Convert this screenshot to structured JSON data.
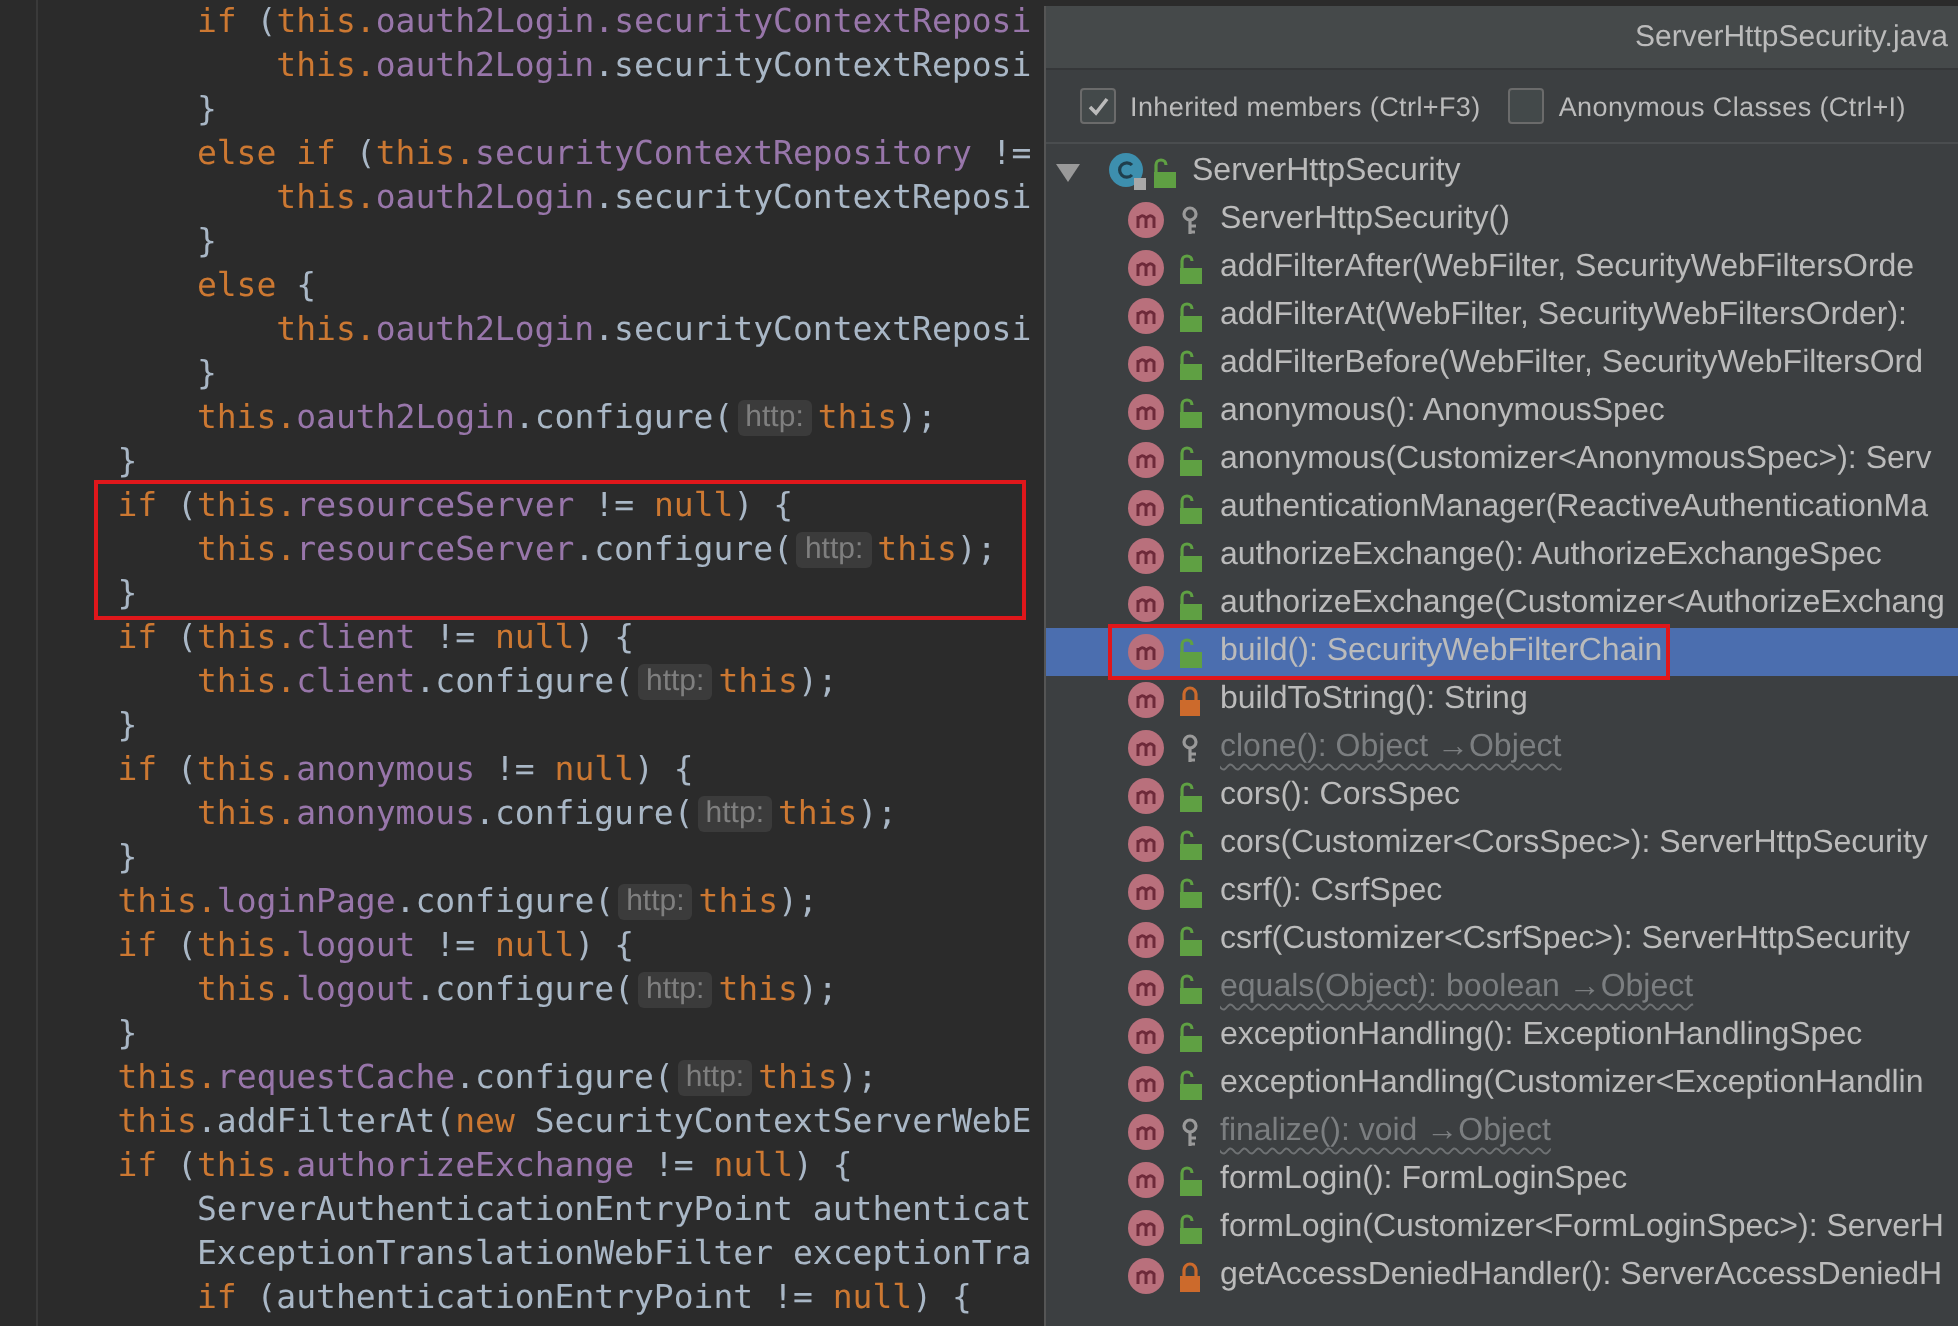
{
  "editor": {
    "lines": [
      {
        "boxed": false,
        "children": [
          {
            "parts": [
              {
                "kind": "code",
                "tokens": [
                  {
                    "kind": "kw",
                    "text": "if"
                  },
                  {
                    "kind": "plain",
                    "text": " ("
                  },
                  {
                    "kind": "kw",
                    "text": "this."
                  },
                  {
                    "kind": "field",
                    "text": "oauth2Login.securityContextReposi"
                  }
                ]
              }
            ],
            "children": [
              {
                "parts": [
                  {
                    "kind": "code",
                    "tokens": [
                      {
                        "kind": "kw",
                        "text": "this."
                      },
                      {
                        "kind": "field",
                        "text": "oauth2Login"
                      },
                      {
                        "kind": "plain",
                        "text": ".securityContextReposi"
                      }
                    ]
                  }
                ]
              }
            ],
            "closing": [
              {
                "kind": "code",
                "tokens": [
                  {
                    "kind": "plain",
                    "text": "}"
                  }
                ]
              }
            ]
          },
          {
            "parts": [
              {
                "kind": "code",
                "tokens": [
                  {
                    "kind": "kw",
                    "text": "else if"
                  },
                  {
                    "kind": "plain",
                    "text": " ("
                  },
                  {
                    "kind": "kw",
                    "text": "this."
                  },
                  {
                    "kind": "field",
                    "text": "securityContextRepository"
                  },
                  {
                    "kind": "plain",
                    "text": " !="
                  }
                ]
              }
            ],
            "children": [
              {
                "parts": [
                  {
                    "kind": "code",
                    "tokens": [
                      {
                        "kind": "kw",
                        "text": "this."
                      },
                      {
                        "kind": "field",
                        "text": "oauth2Login"
                      },
                      {
                        "kind": "plain",
                        "text": ".securityContextReposi"
                      }
                    ]
                  }
                ]
              }
            ],
            "closing": [
              {
                "kind": "code",
                "tokens": [
                  {
                    "kind": "plain",
                    "text": "}"
                  }
                ]
              }
            ]
          },
          {
            "parts": [
              {
                "kind": "code",
                "tokens": [
                  {
                    "kind": "kw",
                    "text": "else"
                  },
                  {
                    "kind": "plain",
                    "text": " {"
                  }
                ]
              }
            ],
            "children": [
              {
                "parts": [
                  {
                    "kind": "code",
                    "tokens": [
                      {
                        "kind": "kw",
                        "text": "this."
                      },
                      {
                        "kind": "field",
                        "text": "oauth2Login"
                      },
                      {
                        "kind": "plain",
                        "text": ".securityContextReposi"
                      }
                    ]
                  }
                ]
              }
            ],
            "closing": [
              {
                "kind": "code",
                "tokens": [
                  {
                    "kind": "plain",
                    "text": "}"
                  }
                ]
              }
            ]
          },
          {
            "parts": [
              {
                "kind": "code",
                "tokens": [
                  {
                    "kind": "kw",
                    "text": "this."
                  },
                  {
                    "kind": "field",
                    "text": "oauth2Login"
                  },
                  {
                    "kind": "plain",
                    "text": ".configure("
                  }
                ]
              },
              {
                "kind": "hint",
                "text": "http:"
              },
              {
                "kind": "code",
                "tokens": [
                  {
                    "kind": "kw",
                    "text": "this"
                  },
                  {
                    "kind": "plain",
                    "text": ");"
                  }
                ]
              }
            ]
          }
        ],
        "closing": [
          {
            "kind": "code",
            "tokens": [
              {
                "kind": "plain",
                "text": "}"
              }
            ]
          }
        ]
      },
      {
        "boxed": true,
        "parts": [
          {
            "kind": "code",
            "tokens": [
              {
                "kind": "kw",
                "text": "if"
              },
              {
                "kind": "plain",
                "text": " ("
              },
              {
                "kind": "kw",
                "text": "this."
              },
              {
                "kind": "field",
                "text": "resourceServer"
              },
              {
                "kind": "plain",
                "text": " != "
              },
              {
                "kind": "kw",
                "text": "null"
              },
              {
                "kind": "plain",
                "text": ") {"
              }
            ]
          }
        ],
        "children": [
          {
            "parts": [
              {
                "kind": "code",
                "tokens": [
                  {
                    "kind": "kw",
                    "text": "this."
                  },
                  {
                    "kind": "field",
                    "text": "resourceServer"
                  },
                  {
                    "kind": "plain",
                    "text": ".configure("
                  }
                ]
              },
              {
                "kind": "hint",
                "text": "http:"
              },
              {
                "kind": "code",
                "tokens": [
                  {
                    "kind": "kw",
                    "text": "this"
                  },
                  {
                    "kind": "plain",
                    "text": ");"
                  }
                ]
              }
            ]
          }
        ],
        "closing": [
          {
            "kind": "code",
            "tokens": [
              {
                "kind": "plain",
                "text": "}"
              }
            ]
          }
        ]
      },
      {
        "boxed": false,
        "parts": [
          {
            "kind": "code",
            "tokens": [
              {
                "kind": "kw",
                "text": "if"
              },
              {
                "kind": "plain",
                "text": " ("
              },
              {
                "kind": "kw",
                "text": "this."
              },
              {
                "kind": "field",
                "text": "client"
              },
              {
                "kind": "plain",
                "text": " != "
              },
              {
                "kind": "kw",
                "text": "null"
              },
              {
                "kind": "plain",
                "text": ") {"
              }
            ]
          }
        ],
        "children": [
          {
            "parts": [
              {
                "kind": "code",
                "tokens": [
                  {
                    "kind": "kw",
                    "text": "this."
                  },
                  {
                    "kind": "field",
                    "text": "client"
                  },
                  {
                    "kind": "plain",
                    "text": ".configure("
                  }
                ]
              },
              {
                "kind": "hint",
                "text": "http:"
              },
              {
                "kind": "code",
                "tokens": [
                  {
                    "kind": "kw",
                    "text": "this"
                  },
                  {
                    "kind": "plain",
                    "text": ");"
                  }
                ]
              }
            ]
          }
        ],
        "closing": [
          {
            "kind": "code",
            "tokens": [
              {
                "kind": "plain",
                "text": "}"
              }
            ]
          }
        ]
      },
      {
        "boxed": false,
        "parts": [
          {
            "kind": "code",
            "tokens": [
              {
                "kind": "kw",
                "text": "if"
              },
              {
                "kind": "plain",
                "text": " ("
              },
              {
                "kind": "kw",
                "text": "this."
              },
              {
                "kind": "field",
                "text": "anonymous"
              },
              {
                "kind": "plain",
                "text": " != "
              },
              {
                "kind": "kw",
                "text": "null"
              },
              {
                "kind": "plain",
                "text": ") {"
              }
            ]
          }
        ],
        "children": [
          {
            "parts": [
              {
                "kind": "code",
                "tokens": [
                  {
                    "kind": "kw",
                    "text": "this."
                  },
                  {
                    "kind": "field",
                    "text": "anonymous"
                  },
                  {
                    "kind": "plain",
                    "text": ".configure("
                  }
                ]
              },
              {
                "kind": "hint",
                "text": "http:"
              },
              {
                "kind": "code",
                "tokens": [
                  {
                    "kind": "kw",
                    "text": "this"
                  },
                  {
                    "kind": "plain",
                    "text": ");"
                  }
                ]
              }
            ]
          }
        ],
        "closing": [
          {
            "kind": "code",
            "tokens": [
              {
                "kind": "plain",
                "text": "}"
              }
            ]
          }
        ]
      },
      {
        "boxed": false,
        "parts": [
          {
            "kind": "code",
            "tokens": [
              {
                "kind": "kw",
                "text": "this."
              },
              {
                "kind": "field",
                "text": "loginPage"
              },
              {
                "kind": "plain",
                "text": ".configure("
              }
            ]
          },
          {
            "kind": "hint",
            "text": "http:"
          },
          {
            "kind": "code",
            "tokens": [
              {
                "kind": "kw",
                "text": "this"
              },
              {
                "kind": "plain",
                "text": ");"
              }
            ]
          }
        ]
      },
      {
        "boxed": false,
        "parts": [
          {
            "kind": "code",
            "tokens": [
              {
                "kind": "kw",
                "text": "if"
              },
              {
                "kind": "plain",
                "text": " ("
              },
              {
                "kind": "kw",
                "text": "this."
              },
              {
                "kind": "field",
                "text": "logout"
              },
              {
                "kind": "plain",
                "text": " != "
              },
              {
                "kind": "kw",
                "text": "null"
              },
              {
                "kind": "plain",
                "text": ") {"
              }
            ]
          }
        ],
        "children": [
          {
            "parts": [
              {
                "kind": "code",
                "tokens": [
                  {
                    "kind": "kw",
                    "text": "this."
                  },
                  {
                    "kind": "field",
                    "text": "logout"
                  },
                  {
                    "kind": "plain",
                    "text": ".configure("
                  }
                ]
              },
              {
                "kind": "hint",
                "text": "http:"
              },
              {
                "kind": "code",
                "tokens": [
                  {
                    "kind": "kw",
                    "text": "this"
                  },
                  {
                    "kind": "plain",
                    "text": ");"
                  }
                ]
              }
            ]
          }
        ],
        "closing": [
          {
            "kind": "code",
            "tokens": [
              {
                "kind": "plain",
                "text": "}"
              }
            ]
          }
        ]
      },
      {
        "boxed": false,
        "parts": [
          {
            "kind": "code",
            "tokens": [
              {
                "kind": "kw",
                "text": "this."
              },
              {
                "kind": "field",
                "text": "requestCache"
              },
              {
                "kind": "plain",
                "text": ".configure("
              }
            ]
          },
          {
            "kind": "hint",
            "text": "http:"
          },
          {
            "kind": "code",
            "tokens": [
              {
                "kind": "kw",
                "text": "this"
              },
              {
                "kind": "plain",
                "text": ");"
              }
            ]
          }
        ]
      },
      {
        "boxed": false,
        "parts": [
          {
            "kind": "code",
            "tokens": [
              {
                "kind": "kw",
                "text": "this"
              },
              {
                "kind": "plain",
                "text": ".addFilterAt("
              },
              {
                "kind": "kw",
                "text": "new"
              },
              {
                "kind": "plain",
                "text": " SecurityContextServerWebE"
              }
            ]
          }
        ]
      },
      {
        "boxed": false,
        "parts": [
          {
            "kind": "code",
            "tokens": [
              {
                "kind": "kw",
                "text": "if"
              },
              {
                "kind": "plain",
                "text": " ("
              },
              {
                "kind": "kw",
                "text": "this."
              },
              {
                "kind": "field",
                "text": "authorizeExchange"
              },
              {
                "kind": "plain",
                "text": " != "
              },
              {
                "kind": "kw",
                "text": "null"
              },
              {
                "kind": "plain",
                "text": ") {"
              }
            ]
          }
        ],
        "children": [
          {
            "parts": [
              {
                "kind": "code",
                "tokens": [
                  {
                    "kind": "plain",
                    "text": "ServerAuthenticationEntryPoint authenticat"
                  }
                ]
              }
            ]
          },
          {
            "parts": [
              {
                "kind": "code",
                "tokens": [
                  {
                    "kind": "plain",
                    "text": "ExceptionTranslationWebFilter exceptionTra"
                  }
                ]
              }
            ]
          },
          {
            "parts": [
              {
                "kind": "code",
                "tokens": [
                  {
                    "kind": "kw",
                    "text": "if"
                  },
                  {
                    "kind": "plain",
                    "text": " (authenticationEntryPoint != "
                  },
                  {
                    "kind": "kw",
                    "text": "null"
                  },
                  {
                    "kind": "plain",
                    "text": ") {"
                  }
                ]
              }
            ]
          }
        ]
      }
    ]
  },
  "structure_popup": {
    "title": "ServerHttpSecurity.java",
    "options": [
      {
        "label": "Inherited members (Ctrl+F3)",
        "checked": true
      },
      {
        "label": "Anonymous Classes (Ctrl+I)",
        "checked": false
      }
    ],
    "class_node": {
      "name": "ServerHttpSecurity",
      "expanded": true,
      "members": [
        {
          "name": "ServerHttpSecurity()",
          "kind": "package",
          "inherited": false,
          "selected": false,
          "boxed": false
        },
        {
          "name": "addFilterAfter(WebFilter, SecurityWebFiltersOrde",
          "kind": "public",
          "inherited": false,
          "selected": false,
          "boxed": false
        },
        {
          "name": "addFilterAt(WebFilter, SecurityWebFiltersOrder):",
          "kind": "public",
          "inherited": false,
          "selected": false,
          "boxed": false
        },
        {
          "name": "addFilterBefore(WebFilter, SecurityWebFiltersOrd",
          "kind": "public",
          "inherited": false,
          "selected": false,
          "boxed": false
        },
        {
          "name": "anonymous(): AnonymousSpec",
          "kind": "public",
          "inherited": false,
          "selected": false,
          "boxed": false
        },
        {
          "name": "anonymous(Customizer<AnonymousSpec>): Serv",
          "kind": "public",
          "inherited": false,
          "selected": false,
          "boxed": false
        },
        {
          "name": "authenticationManager(ReactiveAuthenticationMa",
          "kind": "public",
          "inherited": false,
          "selected": false,
          "boxed": false
        },
        {
          "name": "authorizeExchange(): AuthorizeExchangeSpec",
          "kind": "public",
          "inherited": false,
          "selected": false,
          "boxed": false
        },
        {
          "name": "authorizeExchange(Customizer<AuthorizeExchang",
          "kind": "public",
          "inherited": false,
          "selected": false,
          "boxed": false
        },
        {
          "name": "build(): SecurityWebFilterChain",
          "kind": "public",
          "inherited": false,
          "selected": true,
          "boxed": true
        },
        {
          "name": "buildToString(): String",
          "kind": "private",
          "inherited": false,
          "selected": false,
          "boxed": false
        },
        {
          "name": "clone(): Object →Object",
          "kind": "package",
          "inherited": true,
          "selected": false,
          "boxed": false
        },
        {
          "name": "cors(): CorsSpec",
          "kind": "public",
          "inherited": false,
          "selected": false,
          "boxed": false
        },
        {
          "name": "cors(Customizer<CorsSpec>): ServerHttpSecurity",
          "kind": "public",
          "inherited": false,
          "selected": false,
          "boxed": false
        },
        {
          "name": "csrf(): CsrfSpec",
          "kind": "public",
          "inherited": false,
          "selected": false,
          "boxed": false
        },
        {
          "name": "csrf(Customizer<CsrfSpec>): ServerHttpSecurity",
          "kind": "public",
          "inherited": false,
          "selected": false,
          "boxed": false
        },
        {
          "name": "equals(Object): boolean →Object",
          "kind": "public",
          "inherited": true,
          "selected": false,
          "boxed": false
        },
        {
          "name": "exceptionHandling(): ExceptionHandlingSpec",
          "kind": "public",
          "inherited": false,
          "selected": false,
          "boxed": false
        },
        {
          "name": "exceptionHandling(Customizer<ExceptionHandlin",
          "kind": "public",
          "inherited": false,
          "selected": false,
          "boxed": false
        },
        {
          "name": "finalize(): void →Object",
          "kind": "package",
          "inherited": true,
          "selected": false,
          "boxed": false
        },
        {
          "name": "formLogin(): FormLoginSpec",
          "kind": "public",
          "inherited": false,
          "selected": false,
          "boxed": false
        },
        {
          "name": "formLogin(Customizer<FormLoginSpec>): ServerH",
          "kind": "public",
          "inherited": false,
          "selected": false,
          "boxed": false
        },
        {
          "name": "getAccessDeniedHandler(): ServerAccessDeniedH",
          "kind": "private",
          "inherited": false,
          "selected": false,
          "boxed": false
        }
      ]
    }
  }
}
